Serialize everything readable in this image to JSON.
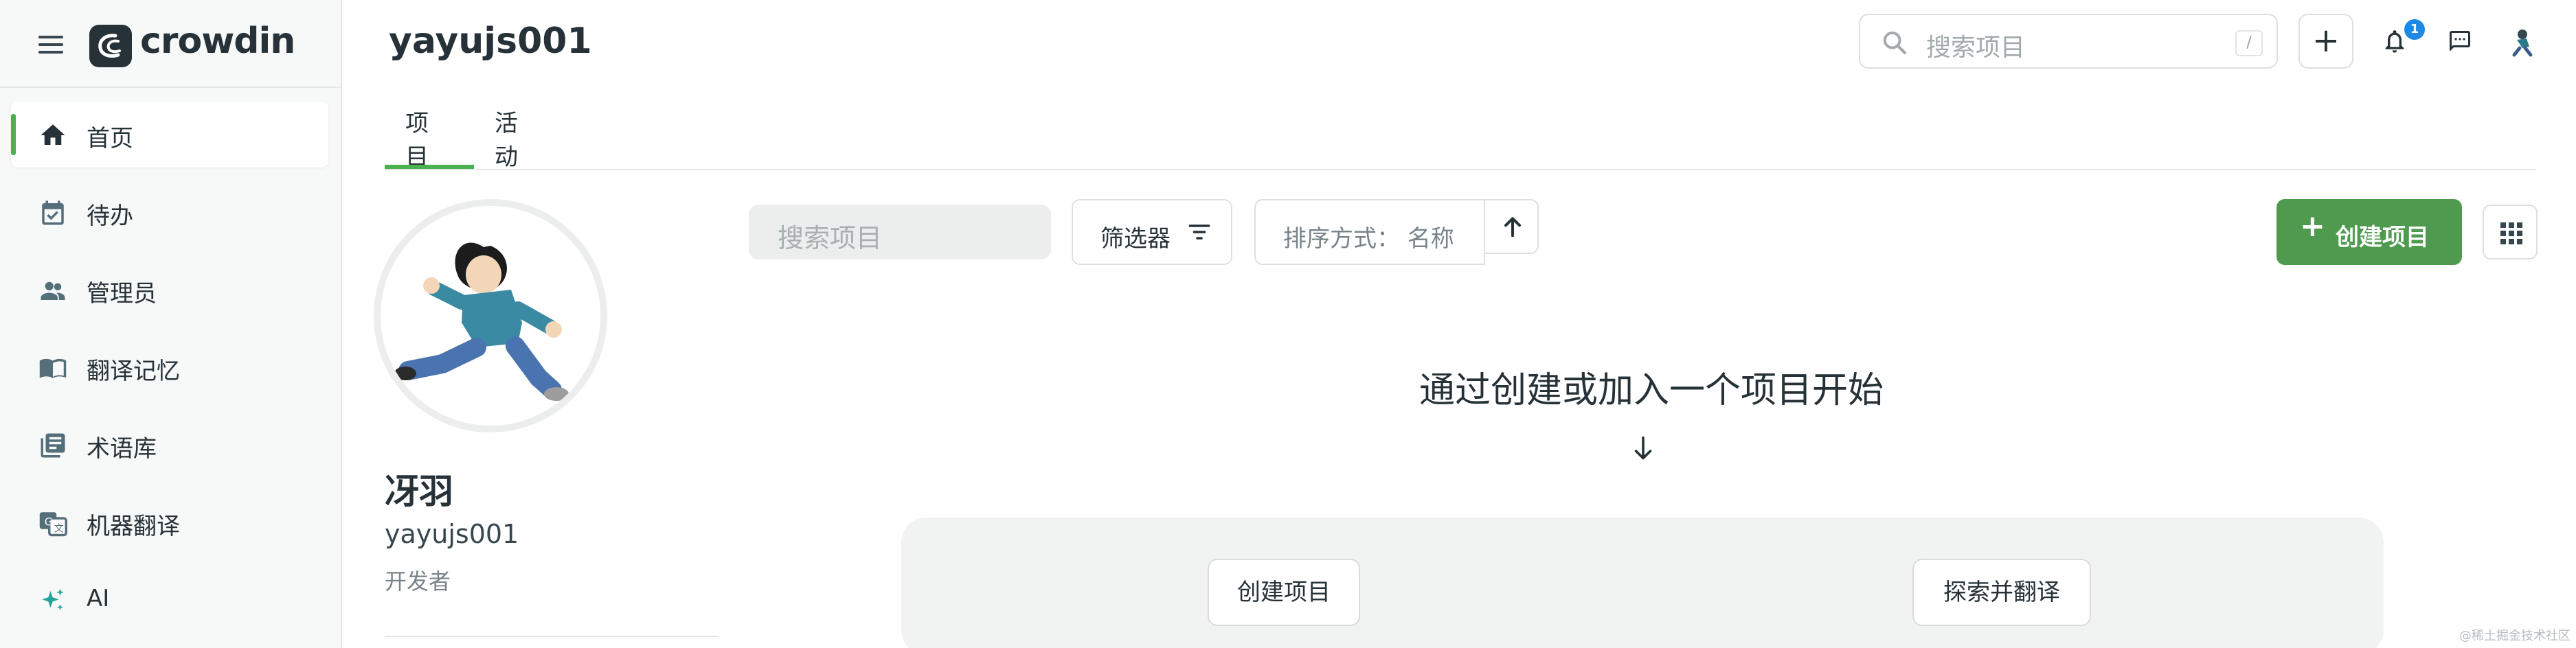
{
  "brand": {
    "name": "crowdin"
  },
  "sidebar": {
    "items": [
      {
        "label": "首页",
        "icon": "home-icon",
        "active": true
      },
      {
        "label": "待办",
        "icon": "calendar-check-icon"
      },
      {
        "label": "管理员",
        "icon": "people-icon"
      },
      {
        "label": "翻译记忆",
        "icon": "book-icon"
      },
      {
        "label": "术语库",
        "icon": "library-icon"
      },
      {
        "label": "机器翻译",
        "icon": "machine-translate-icon"
      },
      {
        "label": "AI",
        "icon": "sparkle-icon"
      }
    ]
  },
  "header": {
    "title": "yayujs001",
    "search_placeholder": "搜索项目",
    "search_shortcut": "/",
    "notification_count": "1"
  },
  "tabs": [
    {
      "label": "项目",
      "active": true
    },
    {
      "label": "活动"
    }
  ],
  "profile": {
    "display_name": "冴羽",
    "username": "yayujs001",
    "role": "开发者"
  },
  "toolbar": {
    "search_placeholder": "搜索项目",
    "filter_label": "筛选器",
    "sort_label": "排序方式：  名称",
    "create_label": "创建项目"
  },
  "empty_state": {
    "title": "通过创建或加入一个项目开始",
    "create_button": "创建项目",
    "explore_button": "探索并翻译"
  },
  "watermark": "@稀土掘金技术社区",
  "colors": {
    "accent": "#4e9a4e",
    "badge": "#1e88e5"
  }
}
